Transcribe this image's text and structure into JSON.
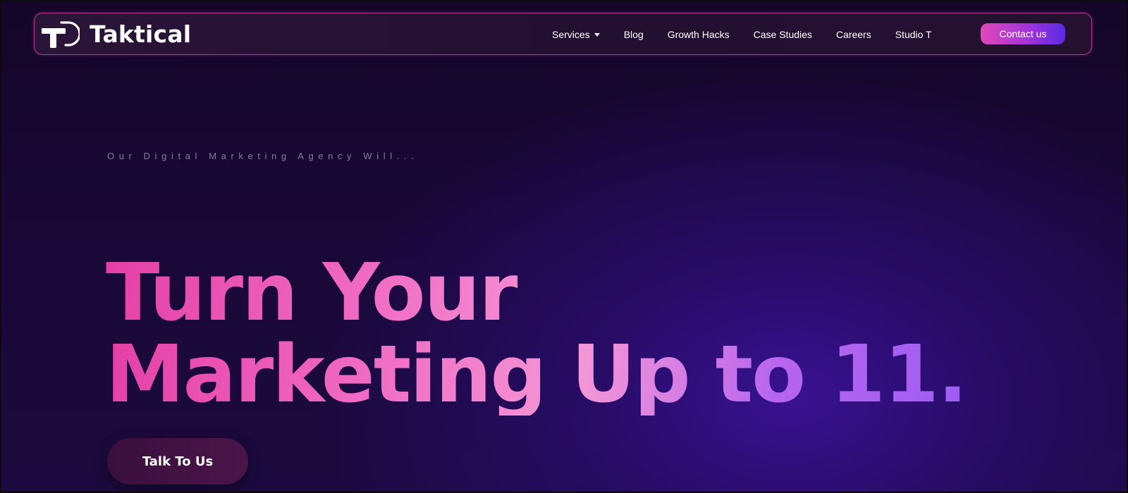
{
  "brand": {
    "name": "Taktical",
    "logo_icon": "taktical-t-logo-icon"
  },
  "nav": {
    "items": [
      {
        "label": "Services",
        "has_dropdown": true
      },
      {
        "label": "Blog"
      },
      {
        "label": "Growth Hacks"
      },
      {
        "label": "Case Studies"
      },
      {
        "label": "Careers"
      },
      {
        "label": "Studio T"
      }
    ],
    "cta_label": "Contact us"
  },
  "hero": {
    "eyebrow": "Our Digital Marketing Agency Will...",
    "headline_line1": "Turn Your",
    "headline_line2": "Marketing Up to 11.",
    "cta_label": "Talk To Us"
  },
  "colors": {
    "background": "#1a0838",
    "accent_pink": "#e248b8",
    "accent_purple": "#5b2ae6",
    "nav_border": "#ec48b2"
  }
}
